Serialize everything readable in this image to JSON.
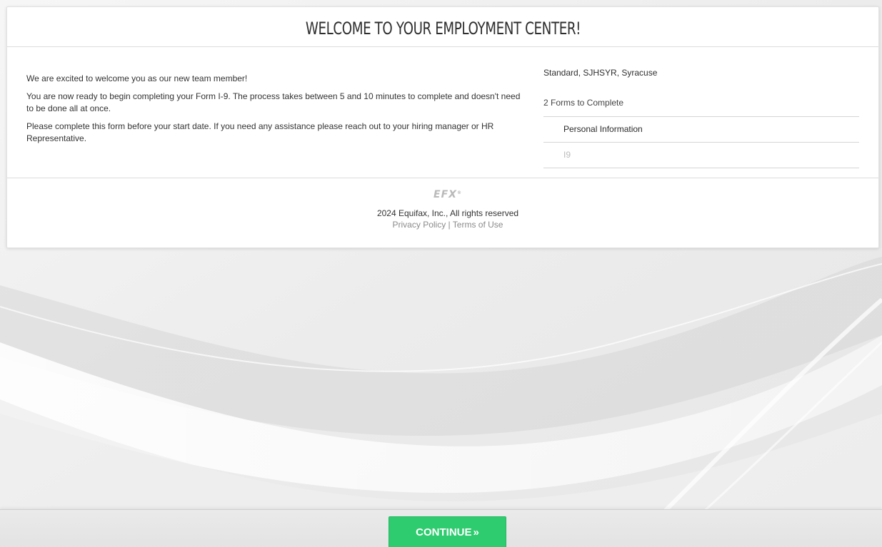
{
  "header": {
    "title": "WELCOME TO YOUR EMPLOYMENT CENTER!"
  },
  "intro": {
    "paragraphs": [
      "We are excited to welcome you as our new team member!",
      "You are now ready to begin completing your Form I-9. The process takes between 5 and 10 minutes to complete and doesn't need to be done all at once.",
      "Please complete this form before your start date. If you need any assistance please reach out to your hiring manager or HR Representative."
    ]
  },
  "forms_panel": {
    "company": "Standard, SJHSYR, Syracuse",
    "forms_count": "2 Forms to Complete",
    "forms": [
      {
        "label": "Personal Information",
        "state": "active"
      },
      {
        "label": "I9",
        "state": "disabled"
      }
    ]
  },
  "footer": {
    "logo_text": "EFX",
    "logo_mark": "®",
    "copyright": "2024 Equifax, Inc., All rights reserved",
    "privacy_label": "Privacy Policy",
    "separator": "|",
    "terms_label": "Terms of Use"
  },
  "actions": {
    "continue_label": "CONTINUE",
    "continue_icon": "»",
    "continue_icon_name": "double-chevron-right-icon"
  },
  "colors": {
    "accent_green": "#2ecc6f",
    "link_gray": "#8a8a8a",
    "background": "#f3f3f3"
  }
}
